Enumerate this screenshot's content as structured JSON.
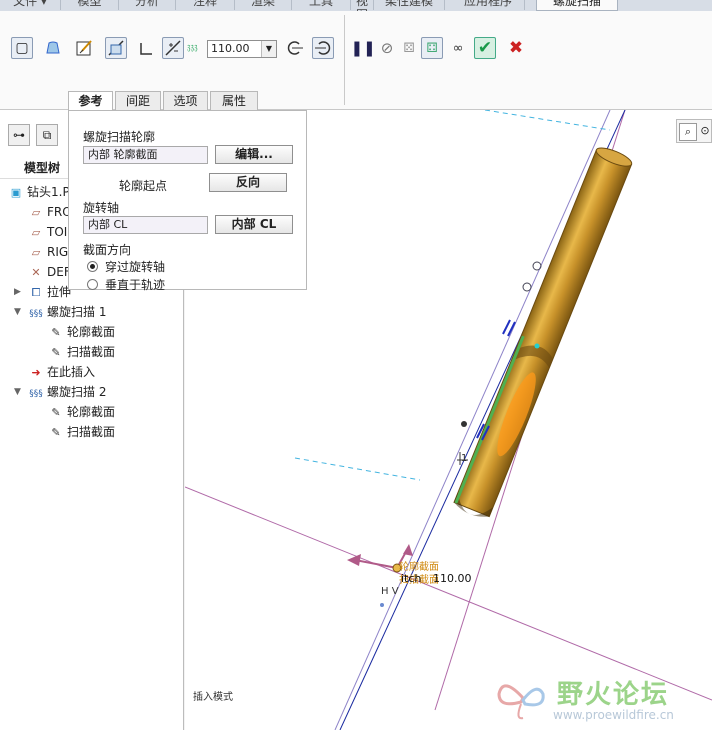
{
  "ribbon_tabs": [
    "文件 ▾",
    "模型",
    "分析",
    "注释",
    "渲染",
    "工具",
    "视图",
    "柔性建模",
    "应用程序",
    "螺旋扫描"
  ],
  "active_tab": "螺旋扫描",
  "pitch": {
    "icon_text": "𝔷𝔷𝔷",
    "value": "110.00"
  },
  "sub_tabs": [
    "参考",
    "间距",
    "选项",
    "属性"
  ],
  "panel": {
    "profile_label": "螺旋扫描轮廓",
    "profile_value": "内部 轮廓截面",
    "edit_button": "编辑...",
    "start_label": "轮廓起点",
    "flip_button": "反向",
    "axis_label": "旋转轴",
    "axis_value": "内部 CL",
    "axis_button": "内部 CL",
    "orient_label": "截面方向",
    "radio_through": "穿过旋转轴",
    "radio_normal": "垂直于轨迹",
    "radio_selected": "穿过旋转轴"
  },
  "model_tree": {
    "title": "模型树",
    "items": [
      {
        "label": "钻头1.P",
        "icon": "part-icon",
        "level": 0
      },
      {
        "label": "FRO",
        "icon": "plane-icon",
        "level": 1
      },
      {
        "label": "TOI",
        "icon": "plane-icon",
        "level": 1
      },
      {
        "label": "RIG",
        "icon": "plane-icon",
        "level": 1
      },
      {
        "label": "DEF",
        "icon": "csys-icon",
        "level": 1
      },
      {
        "label": "拉伸",
        "icon": "extrude-icon",
        "level": 1
      },
      {
        "label": "螺旋扫描 1",
        "icon": "helical-icon",
        "level": 1
      },
      {
        "label": "轮廓截面",
        "icon": "sketch-icon",
        "level": 2
      },
      {
        "label": "扫描截面",
        "icon": "sketch-icon",
        "level": 2
      },
      {
        "label": "在此插入",
        "icon": "insert-arrow-icon",
        "level": 1
      },
      {
        "label": "螺旋扫描 2",
        "icon": "helical-icon",
        "level": 1
      },
      {
        "label": "轮廓截面",
        "icon": "sketch-icon",
        "level": 2
      },
      {
        "label": "扫描截面",
        "icon": "sketch-icon",
        "level": 2
      }
    ]
  },
  "viewport": {
    "dim_label_1": "轮廓截面",
    "dim_label_2": "扫描截面",
    "pitch_dim": "110.00",
    "pitch_prefix": "itch",
    "hv_label": "H V",
    "marker_label": "1",
    "status_text": "插入模式"
  },
  "watermark": {
    "text": "野火论坛",
    "url": "www.proewildfire.cn"
  }
}
